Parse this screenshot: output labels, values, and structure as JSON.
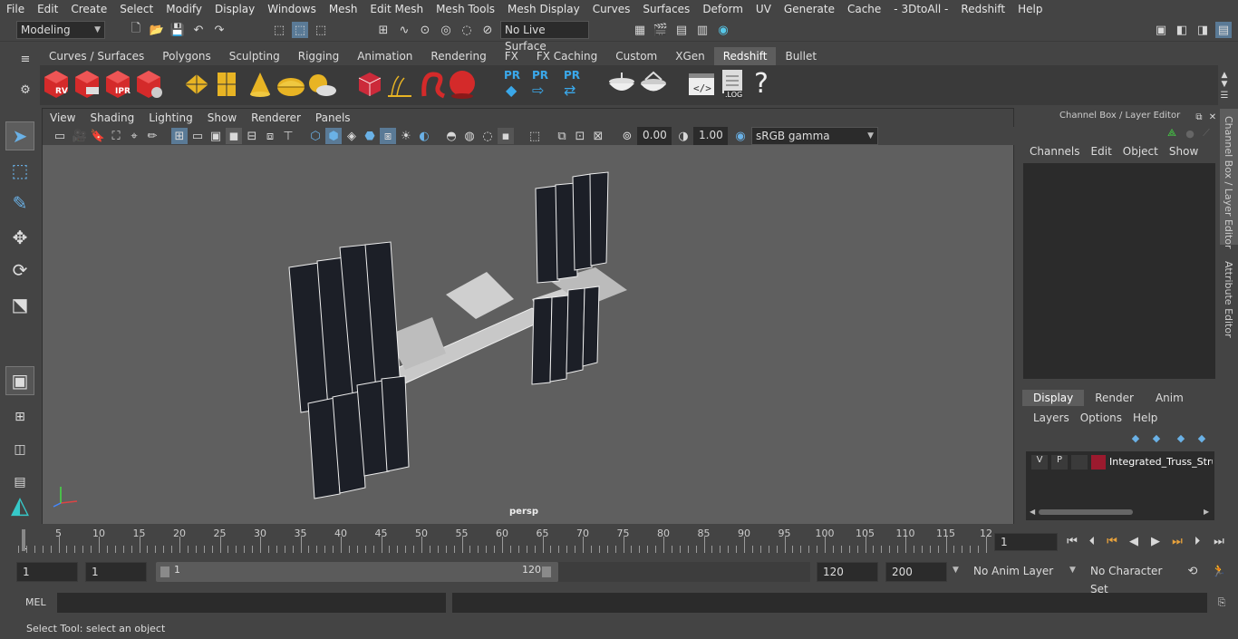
{
  "menu": [
    "File",
    "Edit",
    "Create",
    "Select",
    "Modify",
    "Display",
    "Windows",
    "Mesh",
    "Edit Mesh",
    "Mesh Tools",
    "Mesh Display",
    "Curves",
    "Surfaces",
    "Deform",
    "UV",
    "Generate",
    "Cache",
    "- 3DtoAll -",
    "Redshift",
    "Help"
  ],
  "status": {
    "mode": "Modeling",
    "live_surface": "No Live Surface"
  },
  "shelf_tabs": [
    "Curves / Surfaces",
    "Polygons",
    "Sculpting",
    "Rigging",
    "Animation",
    "Rendering",
    "FX",
    "FX Caching",
    "Custom",
    "XGen",
    "Redshift",
    "Bullet"
  ],
  "active_tab": "Redshift",
  "shelf_labels": {
    "rv": "RV",
    "ipr": "IPR",
    "pr1": "PR",
    "pr2": "PR",
    "pr3": "PR",
    "log": ".LOG",
    "help": "?"
  },
  "panel_menu": [
    "View",
    "Shading",
    "Lighting",
    "Show",
    "Renderer",
    "Panels"
  ],
  "panel_toolbar": {
    "exposure": "0.00",
    "gamma": "1.00",
    "colorspace": "sRGB gamma"
  },
  "viewport": {
    "camera": "persp"
  },
  "channel_box": {
    "title": "Channel Box / Layer Editor",
    "menu": [
      "Channels",
      "Edit",
      "Object",
      "Show"
    ]
  },
  "layer_editor": {
    "tabs": [
      "Display",
      "Render",
      "Anim"
    ],
    "menu": [
      "Layers",
      "Options",
      "Help"
    ],
    "layer": {
      "v": "V",
      "p": "P",
      "name": "Integrated_Truss_Struc",
      "color": "#9b1a2e"
    }
  },
  "side_tabs": {
    "channel": "Channel Box / Layer Editor",
    "attr": "Attribute Editor"
  },
  "timeline": {
    "ticks": [
      "5",
      "10",
      "15",
      "20",
      "25",
      "30",
      "35",
      "40",
      "45",
      "50",
      "55",
      "60",
      "65",
      "70",
      "75",
      "80",
      "85",
      "90",
      "95",
      "100",
      "105",
      "110",
      "115",
      "12"
    ],
    "start_label": "1",
    "current": "1"
  },
  "range": {
    "start": "1",
    "playback_start": "1",
    "slider_start": "1",
    "slider_end": "120",
    "end": "120",
    "anim_end": "200",
    "anim_layer": "No Anim Layer",
    "char_set": "No Character Set"
  },
  "cmdline": {
    "label": "MEL"
  },
  "help_line": "Select Tool: select an object"
}
